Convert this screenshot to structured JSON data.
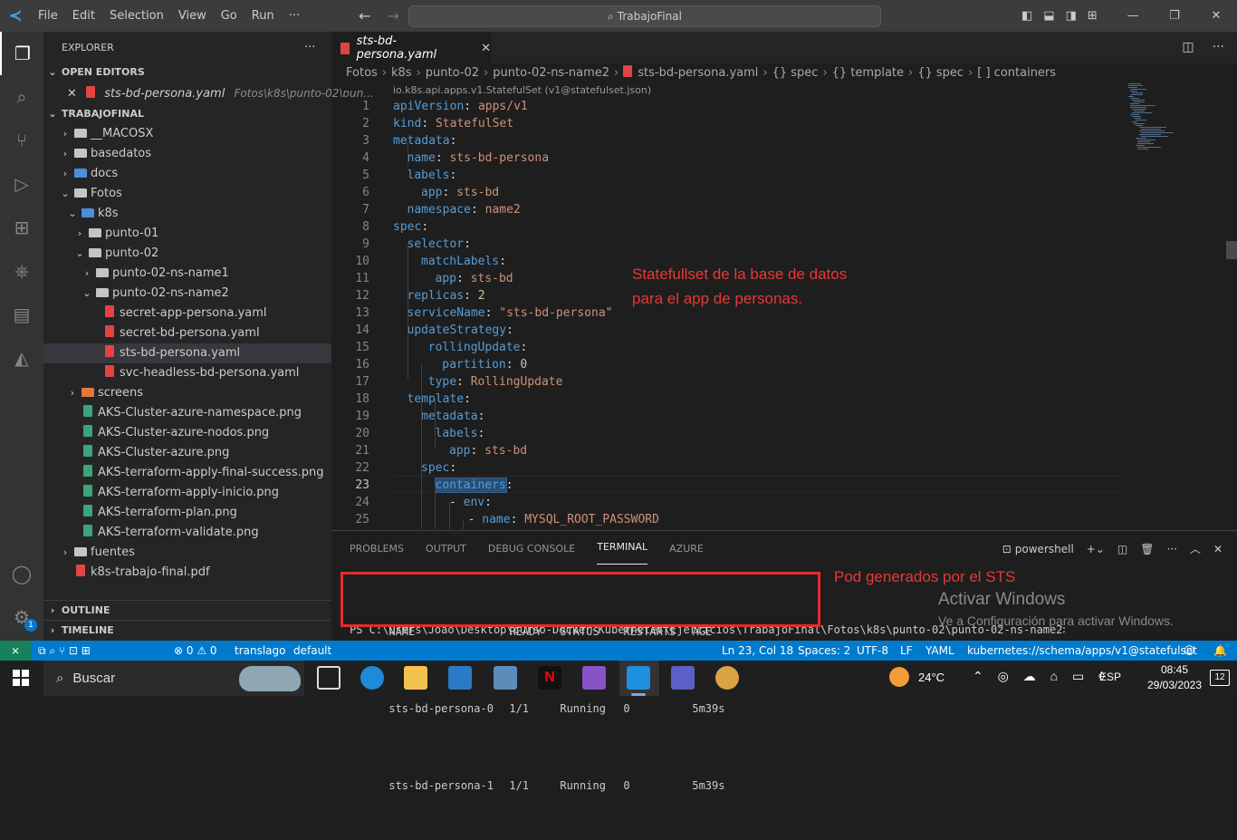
{
  "titlebar": {
    "menus": [
      "File",
      "Edit",
      "Selection",
      "View",
      "Go",
      "Run",
      "···"
    ],
    "search_text": "TrabajoFinal"
  },
  "sidebar": {
    "title": "EXPLORER",
    "more": "···",
    "open_editors_label": "OPEN EDITORS",
    "open_editor": {
      "name": "sts-bd-persona.yaml",
      "path": "Fotos\\k8s\\punto-02\\pun..."
    },
    "workspace_label": "TRABAJOFINAL",
    "tree": [
      {
        "label": "__MACOSX",
        "type": "folder",
        "depth": 0,
        "expanded": false
      },
      {
        "label": "basedatos",
        "type": "folder",
        "depth": 0,
        "expanded": false
      },
      {
        "label": "docs",
        "type": "folder-blue",
        "depth": 0,
        "expanded": false
      },
      {
        "label": "Fotos",
        "type": "folder",
        "depth": 0,
        "expanded": true
      },
      {
        "label": "k8s",
        "type": "folder-blue",
        "depth": 1,
        "expanded": true
      },
      {
        "label": "punto-01",
        "type": "folder",
        "depth": 2,
        "expanded": false
      },
      {
        "label": "punto-02",
        "type": "folder",
        "depth": 2,
        "expanded": true
      },
      {
        "label": "punto-02-ns-name1",
        "type": "folder",
        "depth": 3,
        "expanded": false
      },
      {
        "label": "punto-02-ns-name2",
        "type": "folder",
        "depth": 3,
        "expanded": true
      },
      {
        "label": "secret-app-persona.yaml",
        "type": "yaml",
        "depth": 4
      },
      {
        "label": "secret-bd-persona.yaml",
        "type": "yaml",
        "depth": 4
      },
      {
        "label": "sts-bd-persona.yaml",
        "type": "yaml",
        "depth": 4,
        "selected": true
      },
      {
        "label": "svc-headless-bd-persona.yaml",
        "type": "yaml",
        "depth": 4
      },
      {
        "label": "screens",
        "type": "folder-orange",
        "depth": 1,
        "expanded": false
      },
      {
        "label": "AKS-Cluster-azure-namespace.png",
        "type": "png",
        "depth": 1
      },
      {
        "label": "AKS-Cluster-azure-nodos.png",
        "type": "png",
        "depth": 1
      },
      {
        "label": "AKS-Cluster-azure.png",
        "type": "png",
        "depth": 1
      },
      {
        "label": "AKS-terraform-apply-final-success.png",
        "type": "png",
        "depth": 1
      },
      {
        "label": "AKS-terraform-apply-inicio.png",
        "type": "png",
        "depth": 1
      },
      {
        "label": "AKS-terraform-plan.png",
        "type": "png",
        "depth": 1
      },
      {
        "label": "AKS-terraform-validate.png",
        "type": "png",
        "depth": 1
      },
      {
        "label": "fuentes",
        "type": "folder",
        "depth": 0,
        "expanded": false
      },
      {
        "label": "k8s-trabajo-final.pdf",
        "type": "pdf",
        "depth": 0
      }
    ],
    "outline_label": "OUTLINE",
    "timeline_label": "TIMELINE",
    "accounts_badge": "1"
  },
  "editor": {
    "tab_label": "sts-bd-persona.yaml",
    "breadcrumb": [
      "Fotos",
      "k8s",
      "punto-02",
      "punto-02-ns-name2",
      "sts-bd-persona.yaml",
      "{} spec",
      "{} template",
      "{} spec",
      "[ ] containers"
    ],
    "schema_hint": "io.k8s.api.apps.v1.StatefulSet (v1@statefulset.json)",
    "current_line": 23,
    "lines": [
      {
        "n": "1",
        "ind": 0,
        "k": "apiVersion",
        "v": "apps/v1"
      },
      {
        "n": "2",
        "ind": 0,
        "k": "kind",
        "v": "StatefulSet"
      },
      {
        "n": "3",
        "ind": 0,
        "k": "metadata",
        "v": ""
      },
      {
        "n": "4",
        "ind": 1,
        "k": "name",
        "v": "sts-bd-persona"
      },
      {
        "n": "5",
        "ind": 1,
        "k": "labels",
        "v": ""
      },
      {
        "n": "6",
        "ind": 2,
        "k": "app",
        "v": "sts-bd"
      },
      {
        "n": "7",
        "ind": 1,
        "k": "namespace",
        "v": "name2"
      },
      {
        "n": "8",
        "ind": 0,
        "k": "spec",
        "v": ""
      },
      {
        "n": "9",
        "ind": 1,
        "k": "selector",
        "v": ""
      },
      {
        "n": "10",
        "ind": 2,
        "k": "matchLabels",
        "v": ""
      },
      {
        "n": "11",
        "ind": 3,
        "k": "app",
        "v": "sts-bd"
      },
      {
        "n": "12",
        "ind": 1,
        "k": "replicas",
        "v": "2",
        "num": true
      },
      {
        "n": "13",
        "ind": 1,
        "k": "serviceName",
        "v": "\"sts-bd-persona\""
      },
      {
        "n": "14",
        "ind": 1,
        "k": "updateStrategy",
        "v": ""
      },
      {
        "n": "15",
        "ind": 2.5,
        "k": "rollingUpdate",
        "v": ""
      },
      {
        "n": "16",
        "ind": 3.5,
        "k": "partition",
        "v": "0",
        "num": true
      },
      {
        "n": "17",
        "ind": 2.5,
        "k": "type",
        "v": "RollingUpdate"
      },
      {
        "n": "18",
        "ind": 1,
        "k": "template",
        "v": ""
      },
      {
        "n": "19",
        "ind": 2,
        "k": "metadata",
        "v": ""
      },
      {
        "n": "20",
        "ind": 3,
        "k": "labels",
        "v": ""
      },
      {
        "n": "21",
        "ind": 4,
        "k": "app",
        "v": "sts-bd"
      },
      {
        "n": "22",
        "ind": 2,
        "k": "spec",
        "v": ""
      },
      {
        "n": "23",
        "ind": 3,
        "k": "containers",
        "v": "",
        "hl": true
      },
      {
        "n": "24",
        "ind": 4,
        "k": "env",
        "v": "",
        "dash": true
      },
      {
        "n": "25",
        "ind": 5.33,
        "k": "name",
        "v": "MYSQL_ROOT_PASSWORD",
        "dash": true
      }
    ],
    "annotation": "Statefullset de la base de datos para el app de personas."
  },
  "panel": {
    "tabs": [
      "PROBLEMS",
      "OUTPUT",
      "DEBUG CONSOLE",
      "TERMINAL",
      "AZURE"
    ],
    "active_tab": "TERMINAL",
    "shell_label": "powershell",
    "terminal_headers": [
      "NAME",
      "READY",
      "STATUS",
      "RESTARTS",
      "AGE"
    ],
    "terminal_rows": [
      [
        "sts-bd-persona-0",
        "1/1",
        "Running",
        "0",
        "5m39s"
      ],
      [
        "sts-bd-persona-1",
        "1/1",
        "Running",
        "0",
        "5m39s"
      ]
    ],
    "prompt": "PS C:\\Users\\Joao\\Desktop\\curso-Docker-Kubernetes\\Ejercicios\\TrabajoFinal\\Fotos\\k8s\\punto-02\\punto-02-ns-name2>",
    "annotation": "Pod generados por el STS",
    "activate_title": "Activar Windows",
    "activate_sub": "Ve a Configuración para activar Windows."
  },
  "statusbar": {
    "problems": "⊗ 0 ⚠ 0",
    "account": "translago",
    "namespace": "default",
    "position": "Ln 23, Col 18",
    "spaces": "Spaces: 2",
    "encoding": "UTF-8",
    "eol": "LF",
    "language": "YAML",
    "schema": "kubernetes://schema/apps/v1@statefulset"
  },
  "taskbar": {
    "search_label": "Buscar",
    "weather": "24°C",
    "language": "ESP",
    "time": "08:45",
    "date": "29/03/2023",
    "notifications": "12"
  },
  "colors": {
    "accent": "#007acc",
    "annotation": "#e53935",
    "terminal_box": "#e52b2b"
  }
}
